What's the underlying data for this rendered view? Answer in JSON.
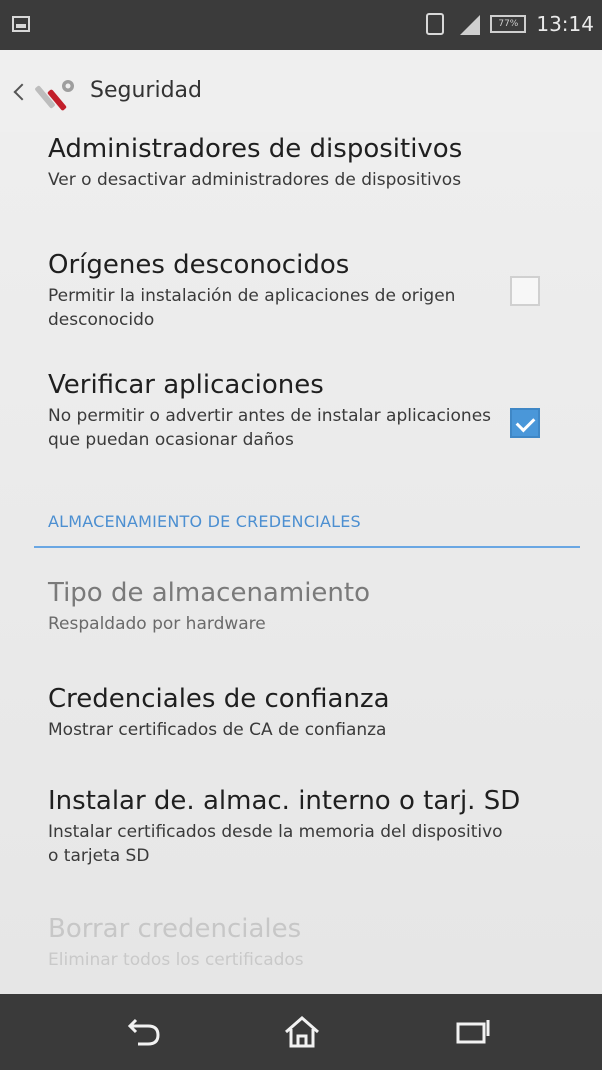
{
  "status_bar": {
    "time": "13:14",
    "battery_text": "77%",
    "icons": [
      "storage-icon",
      "nfc-icon",
      "signal-icon",
      "battery-icon"
    ]
  },
  "action_bar": {
    "title": "Seguridad",
    "icons": [
      "back-chevron-icon",
      "settings-tools-icon"
    ]
  },
  "items": [
    {
      "title": "Administradores de dispositivos",
      "summary": "Ver o desactivar administradores de dispositivos"
    },
    {
      "title": "Orígenes desconocidos",
      "summary": "Permitir la instalación de aplicaciones de origen desconocido",
      "checked": false
    },
    {
      "title": "Verificar aplicaciones",
      "summary": "No permitir o advertir antes de instalar aplicaciones que puedan ocasionar daños",
      "checked": true
    }
  ],
  "section_header": "ALMACENAMIENTO DE CREDENCIALES",
  "credential_items": [
    {
      "title": "Tipo de almacenamiento",
      "summary": "Respaldado por hardware",
      "state": "disabled"
    },
    {
      "title": "Credenciales de confianza",
      "summary": "Mostrar certificados de CA de confianza",
      "state": "enabled"
    },
    {
      "title": "Instalar de. almac. interno o tarj. SD",
      "summary": "Instalar certificados desde la memoria del dispositivo o tarjeta SD",
      "state": "enabled"
    },
    {
      "title": "Borrar credenciales",
      "summary": "Eliminar todos los certificados",
      "state": "disabled"
    }
  ],
  "nav_bar": {
    "icons": [
      "back-icon",
      "home-icon",
      "recents-icon"
    ]
  },
  "colors": {
    "accent": "#4c8fd1",
    "status_bar": "#3b3b3b",
    "nav_bar": "#3a3a3a",
    "background": "#e9e9e9"
  }
}
